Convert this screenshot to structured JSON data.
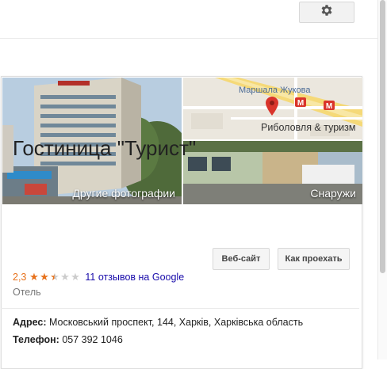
{
  "header": {
    "settings_icon": "gear-icon"
  },
  "panel": {
    "photos": {
      "more_photos_label": "Другие фотографии",
      "map": {
        "street_label": "Маршала Жукова",
        "place_label": "Риболовля & туризм",
        "pin_icon": "map-pin-icon",
        "metro_icon": "metro-icon"
      },
      "outside_label": "Снаружи"
    },
    "title": "Гостиница \"Турист\"",
    "buttons": {
      "website": "Веб-сайт",
      "directions": "Как проехать"
    },
    "rating": {
      "value": "2,3",
      "stars_filled": 2.3,
      "stars_total": 5,
      "reviews_link": "11 отзывов на Google"
    },
    "category": "Отель",
    "address": {
      "label": "Адрес:",
      "value": "Московський проспект, 144, Харків, Харківська область"
    },
    "phone": {
      "label": "Телефон:",
      "value": "057 392 1046"
    }
  },
  "colors": {
    "rating_orange": "#e7711b",
    "link_blue": "#1a0dab",
    "map_pin_red": "#d9342b"
  }
}
